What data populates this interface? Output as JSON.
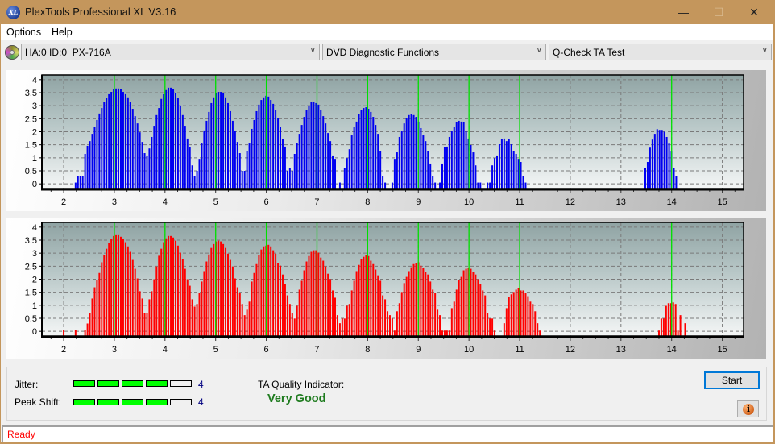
{
  "window": {
    "title": "PlexTools Professional XL V3.16",
    "app_icon_text": "XL",
    "controls": {
      "minimize": "—",
      "maximize": "☐",
      "close": "✕"
    }
  },
  "menu": {
    "items": [
      "Options",
      "Help"
    ]
  },
  "toolbar": {
    "drive_icon": "cd-drive-icon",
    "drive": "HA:0 ID:0  PX-716A",
    "function": "DVD Diagnostic Functions",
    "test": "Q-Check TA Test",
    "chevron": "∨"
  },
  "colors": {
    "title_bar": "#c4965c",
    "top_series": "#0000f0",
    "bottom_series": "#ff0000",
    "reference_line": "#00e000",
    "level_on": "#00ff00",
    "quality_text": "#1e7b1e",
    "status_text": "#ff0000"
  },
  "chart_data": [
    {
      "type": "bar",
      "title": "",
      "xlabel": "",
      "ylabel": "",
      "xlim": [
        1.57,
        15.42
      ],
      "ylim": [
        -0.18,
        4.18
      ],
      "x_ticks": [
        2,
        3,
        4,
        5,
        6,
        7,
        8,
        9,
        10,
        11,
        12,
        13,
        14,
        15
      ],
      "x_minor_step": 0.25,
      "y_ticks": [
        0,
        0.5,
        1,
        1.5,
        2,
        2.5,
        3,
        3.5,
        4
      ],
      "grid": true,
      "reference_lines": [
        3,
        4,
        5,
        6,
        7,
        8,
        9,
        10,
        11,
        14
      ],
      "series": [
        {
          "name": "top",
          "color": "#0000f0",
          "segments": [
            {
              "x_start": 2.0,
              "x_step": 0.047,
              "values": [
                0,
                0,
                0,
                0,
                0,
                0.05,
                0.31,
                0.31,
                0.31,
                1.15,
                1.46,
                1.64,
                1.92,
                2.2,
                2.45,
                2.7,
                2.91,
                3.13,
                3.29,
                3.44,
                3.53,
                3.63,
                3.66,
                3.66,
                3.63,
                3.53,
                3.44,
                3.32,
                3.13,
                2.88,
                2.6,
                2.32,
                1.98,
                1.61,
                1.18,
                1.09,
                1.36,
                1.8,
                2.23,
                2.64,
                2.91,
                3.26,
                3.44,
                3.6,
                3.69,
                3.69,
                3.63,
                3.5,
                3.29,
                3.01,
                2.64,
                2.23,
                1.74,
                1.4,
                0.71,
                0.31,
                0.5,
                0.96,
                1.55,
                2.05,
                2.42,
                2.76,
                3.1,
                3.32,
                3.47,
                3.53,
                3.53,
                3.47,
                3.32,
                3.1,
                2.79,
                2.42,
                2.02,
                1.61,
                1.18,
                0.5,
                0.5,
                1.27,
                1.55,
                2.11,
                2.45,
                2.79,
                3.04,
                3.22,
                3.32,
                3.38,
                3.35,
                3.22,
                3.07,
                2.85,
                2.54,
                2.17,
                1.71,
                1.43,
                0.5,
                0.62,
                0.5,
                1.15,
                1.58,
                1.92,
                2.26,
                2.57,
                2.85,
                3.01,
                3.13,
                3.13,
                3.1,
                3.04,
                2.85,
                2.6,
                2.32,
                1.95,
                1.64,
                1.09,
                0.96,
                0,
                0.05,
                0,
                0.62,
                0.99,
                1.33,
                1.86,
                2.2,
                2.39,
                2.67,
                2.82,
                2.91,
                2.94,
                2.88,
                2.76,
                2.57,
                2.26,
                1.92,
                1.27,
                0.31,
                0.05,
                0,
                0,
                0.05,
                0.96,
                1.21,
                1.8,
                2.02,
                2.32,
                2.51,
                2.64,
                2.67,
                2.64,
                2.57,
                2.39,
                2.14,
                1.86,
                1.64,
                1.27,
                0.78,
                0.31,
                0.05,
                0,
                0.05,
                0.78,
                1.4,
                1.43,
                1.8,
                2.02,
                2.2,
                2.36,
                2.42,
                2.39,
                2.36,
                2.02,
                1.74,
                1.49,
                1.21,
                0.71,
                0.05,
                0.05,
                0,
                0,
                0.05,
                0.05,
                0.71,
                0.99,
                1.09,
                1.52,
                1.71,
                1.74,
                1.64,
                1.71,
                1.52,
                1.27,
                1.15,
                0.96,
                0.84,
                0.31,
                0.05
              ]
            },
            {
              "x_start": 13.48,
              "x_step": 0.047,
              "values": [
                0.62,
                0.84,
                1.39,
                1.7,
                1.92,
                2.1,
                2.07,
                2.07,
                2.0,
                1.8,
                1.55,
                1.24,
                0.62,
                0.31
              ]
            }
          ]
        }
      ]
    },
    {
      "type": "bar",
      "title": "",
      "xlabel": "",
      "ylabel": "",
      "xlim": [
        1.57,
        15.42
      ],
      "ylim": [
        -0.18,
        4.18
      ],
      "x_ticks": [
        2,
        3,
        4,
        5,
        6,
        7,
        8,
        9,
        10,
        11,
        12,
        13,
        14,
        15
      ],
      "x_minor_step": 0.25,
      "y_ticks": [
        0,
        0.5,
        1,
        1.5,
        2,
        2.5,
        3,
        3.5,
        4
      ],
      "grid": true,
      "reference_lines": [
        3,
        4,
        5,
        6,
        7,
        8,
        9,
        10,
        11,
        14
      ],
      "series": [
        {
          "name": "bottom",
          "color": "#ff0000",
          "segments": [
            {
              "x_start": 2.0,
              "x_step": 0.047,
              "values": [
                0.05,
                0,
                0,
                0,
                0,
                0.05,
                0,
                0,
                0,
                0.05,
                0.3,
                0.7,
                1.26,
                1.69,
                1.97,
                2.24,
                2.65,
                2.92,
                3.17,
                3.4,
                3.54,
                3.66,
                3.69,
                3.69,
                3.63,
                3.54,
                3.42,
                3.26,
                3.05,
                2.74,
                2.4,
                2.03,
                1.54,
                1.26,
                0.71,
                0.71,
                1.23,
                1.54,
                2.0,
                2.49,
                2.9,
                3.17,
                3.42,
                3.57,
                3.66,
                3.66,
                3.6,
                3.48,
                3.29,
                3.02,
                2.77,
                2.4,
                2.0,
                1.75,
                1.23,
                0.95,
                1.05,
                1.48,
                1.91,
                2.31,
                2.68,
                2.95,
                3.2,
                3.35,
                3.45,
                3.48,
                3.45,
                3.35,
                3.2,
                2.98,
                2.74,
                2.49,
                2.03,
                1.69,
                1.48,
                1.05,
                0.62,
                0.83,
                1.14,
                1.91,
                2.24,
                2.58,
                2.92,
                3.14,
                3.26,
                3.29,
                3.32,
                3.26,
                3.11,
                2.98,
                2.62,
                2.52,
                2.18,
                1.82,
                1.38,
                1.05,
                0.71,
                0.49,
                0.98,
                1.6,
                1.94,
                2.34,
                2.68,
                2.89,
                3.05,
                3.11,
                3.11,
                3.02,
                2.83,
                2.71,
                2.49,
                2.21,
                2.0,
                1.57,
                1.29,
                0.62,
                0.31,
                0.49,
                0.49,
                0.98,
                1.05,
                1.57,
                1.94,
                2.31,
                2.55,
                2.77,
                2.86,
                2.92,
                2.89,
                2.71,
                2.58,
                2.37,
                2.15,
                1.94,
                1.38,
                1.23,
                0.77,
                0.62,
                0.49,
                0.03,
                0.77,
                1.08,
                1.51,
                1.85,
                2.09,
                2.31,
                2.46,
                2.58,
                2.62,
                2.65,
                2.52,
                2.43,
                2.28,
                2.18,
                1.91,
                1.6,
                1.48,
                0.83,
                0.62,
                0.03,
                0.03,
                0.03,
                0.03,
                0.89,
                1.14,
                1.6,
                1.97,
                2.09,
                2.34,
                2.4,
                2.43,
                2.4,
                2.28,
                2.18,
                2.0,
                1.82,
                1.57,
                1.38,
                0.71,
                0.49,
                0.49,
                0.03,
                0,
                0,
                0,
                0.31,
                0.89,
                1.32,
                1.42,
                1.51,
                1.6,
                1.66,
                1.57,
                1.57,
                1.48,
                1.35,
                1.14,
                1.05,
                0.77,
                0.31,
                0.03
              ]
            },
            {
              "x_start": 13.75,
              "x_step": 0.047,
              "values": [
                0.03,
                0.49,
                0.49,
                0.98,
                1.08,
                1.08,
                1.11,
                1.05,
                0.03,
                0.62,
                0,
                0.31
              ]
            }
          ]
        }
      ]
    }
  ],
  "results": {
    "jitter": {
      "label": "Jitter:",
      "value": "4",
      "level": 4,
      "max": 5
    },
    "peak_shift": {
      "label": "Peak Shift:",
      "value": "4",
      "level": 4,
      "max": 5
    },
    "ta_quality_label": "TA Quality Indicator:",
    "ta_quality_value": "Very Good"
  },
  "buttons": {
    "start": "Start",
    "info_icon_text": "i"
  },
  "status": {
    "text": "Ready"
  }
}
